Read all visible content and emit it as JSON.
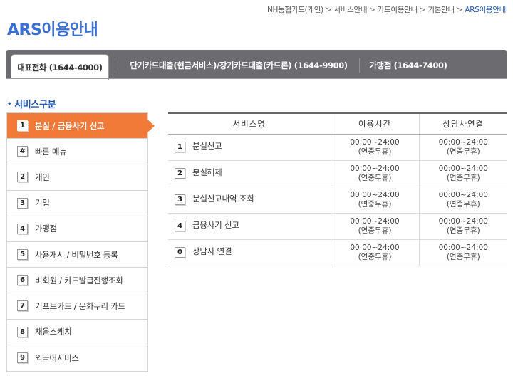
{
  "breadcrumb": {
    "items": [
      "NH농협카드(개인)",
      "서비스안내",
      "카드이용안내",
      "기본안내",
      "ARS이용안내"
    ],
    "separator": ">"
  },
  "page_title": "ARS이용안내",
  "tabs": [
    {
      "label": "대표전화 (1644-4000)",
      "active": true
    },
    {
      "label": "단기카드대출(현금서비스)/장기카드대출(카드론) (1644-9900)",
      "active": false
    },
    {
      "label": "가맹점 (1644-7400)",
      "active": false
    }
  ],
  "section": {
    "title": "서비스구분"
  },
  "menu": {
    "items": [
      {
        "key": "1",
        "label": "분실 / 금융사기 신고",
        "active": true
      },
      {
        "key": "#",
        "label": "빠른 메뉴",
        "active": false
      },
      {
        "key": "2",
        "label": "개인",
        "active": false
      },
      {
        "key": "3",
        "label": "기업",
        "active": false
      },
      {
        "key": "4",
        "label": "가맹점",
        "active": false
      },
      {
        "key": "5",
        "label": "사용개시 / 비밀번호 등록",
        "active": false
      },
      {
        "key": "6",
        "label": "비회원 / 카드발급진행조회",
        "active": false
      },
      {
        "key": "7",
        "label": "기프트카드 / 문화누리 카드",
        "active": false
      },
      {
        "key": "8",
        "label": "채움스케치",
        "active": false
      },
      {
        "key": "9",
        "label": "외국어서비스",
        "active": false
      }
    ]
  },
  "table": {
    "headers": [
      "서비스명",
      "이용시간",
      "상담사연결"
    ],
    "rows": [
      {
        "key": "1",
        "name": "분실신고",
        "time": "00:00~24:00",
        "time_note": "(연중무휴)",
        "agent": "00:00~24:00",
        "agent_note": "(연중무휴)"
      },
      {
        "key": "2",
        "name": "분실해제",
        "time": "00:00~24:00",
        "time_note": "(연중무휴)",
        "agent": "00:00~24:00",
        "agent_note": "(연중무휴)"
      },
      {
        "key": "3",
        "name": "분실신고내역 조회",
        "time": "00:00~24:00",
        "time_note": "(연중무휴)",
        "agent": "00:00~24:00",
        "agent_note": "(연중무휴)"
      },
      {
        "key": "4",
        "name": "금융사기 신고",
        "time": "00:00~24:00",
        "time_note": "(연중무휴)",
        "agent": "00:00~24:00",
        "agent_note": "(연중무휴)"
      },
      {
        "key": "0",
        "name": "상담사 연결",
        "time": "00:00~24:00",
        "time_note": "(연중무휴)",
        "agent": "00:00~24:00",
        "agent_note": "(연중무휴)"
      }
    ]
  },
  "colors": {
    "accent_orange": "#f27a38",
    "title_blue": "#3a6fd0",
    "section_blue": "#1e55b3",
    "tabbar_gray": "#6c6c70"
  }
}
